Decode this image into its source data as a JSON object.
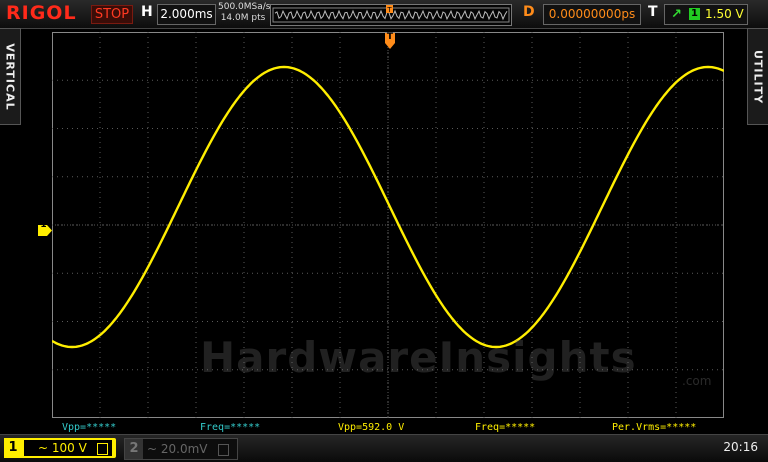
{
  "header": {
    "brand": "RIGOL",
    "run_state": "STOP",
    "horizontal_label": "H",
    "timebase": "2.000ms",
    "sample_rate": "500.0MSa/s",
    "memory_depth": "14.0M pts",
    "delay_label": "D",
    "delay": "0.00000000ps",
    "trigger_label": "T",
    "trigger_edge_icon": "rising-edge-icon",
    "trigger_source": "1",
    "trigger_level": "1.50 V"
  },
  "side_tabs": {
    "left": "VERTICAL",
    "right": "UTILITY"
  },
  "trigger_position_marker": "T",
  "channel1_marker": "1",
  "measurements": [
    {
      "label": "Vpp=*****",
      "color": "#33cccc"
    },
    {
      "label": "Freq=*****",
      "color": "#33cccc"
    },
    {
      "label": "Vpp=592.0 V",
      "color": "#ffee00"
    },
    {
      "label": "Freq=*****",
      "color": "#ffee00"
    },
    {
      "label": "Per.Vrms=*****",
      "color": "#ffee00"
    }
  ],
  "footer": {
    "ch1_number": "1",
    "ch1_scale": "~ 100 V",
    "ch2_number": "2",
    "ch2_scale": "~ 20.0mV",
    "clock": "20:16"
  },
  "watermark": {
    "text": "HardwareInsights",
    "suffix": ".com"
  },
  "colors": {
    "ch1": "#ffee00",
    "run_stop": "#ff2a1a",
    "delay": "#ff8c1a",
    "grid": "#5a5a5a"
  }
}
